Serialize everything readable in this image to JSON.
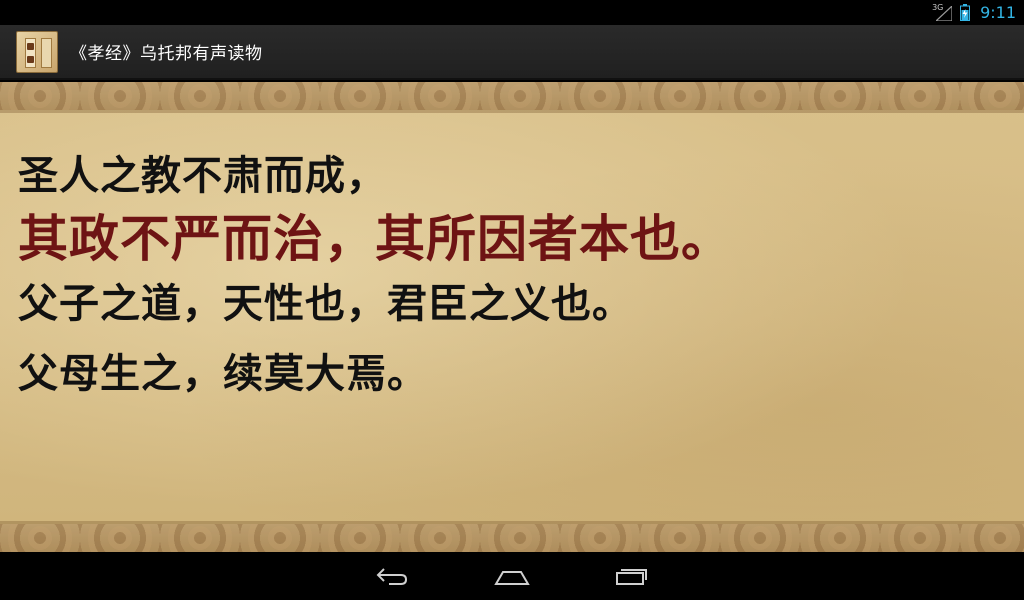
{
  "status_bar": {
    "network": "3G",
    "time": "9:11"
  },
  "action_bar": {
    "title": "《孝经》乌托邦有声读物",
    "app_icon": "book-scroll-icon"
  },
  "content": {
    "verses": [
      "圣人之教不肃而成，",
      "其政不严而治，其所因者本也。",
      "父子之道，天性也，君臣之义也。",
      "父母生之，续莫大焉。"
    ],
    "highlight_color": "#6e1414",
    "text_color": "#111111"
  },
  "nav_bar": {
    "buttons": [
      "back-icon",
      "home-icon",
      "recent-apps-icon"
    ]
  }
}
